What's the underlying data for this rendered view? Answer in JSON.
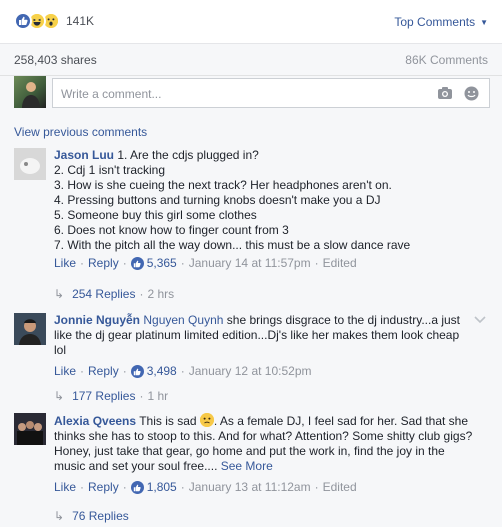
{
  "header": {
    "reaction_icons": [
      "like-icon",
      "haha-icon",
      "wow-icon"
    ],
    "reaction_count": "141K",
    "sort_label": "Top Comments",
    "shares": "258,403 shares",
    "comments": "86K Comments"
  },
  "composer": {
    "placeholder": "Write a comment..."
  },
  "view_previous": "View previous comments",
  "comments": [
    {
      "author": "Jason Luu",
      "lines": [
        "1. Are the cdjs plugged in?",
        "2. Cdj 1 isn't tracking",
        "3. How is she cueing the next track? Her headphones aren't on.",
        "4. Pressing buttons and turning knobs doesn't make you a DJ",
        "5. Someone buy this girl some clothes",
        "6. Does not know how to finger count from 3",
        "7. With the pitch all the way down... this must be a slow dance rave"
      ],
      "like": "Like",
      "reply": "Reply",
      "likes": "5,365",
      "time": "January 14 at 11:57pm",
      "edited": "Edited",
      "replies": "254 Replies",
      "reply_time": "2 hrs"
    },
    {
      "author": "Jonnie Nguyễn",
      "mention": "Nguyen Quynh",
      "lines": [
        "she brings disgrace to the dj industry...a just",
        "like the dj gear platinum limited edition...Dj's like her makes them look cheap",
        "lol"
      ],
      "like": "Like",
      "reply": "Reply",
      "likes": "3,498",
      "time": "January 12 at 10:52pm",
      "replies": "177 Replies",
      "reply_time": "1 hr"
    },
    {
      "author": "Alexia Qveens",
      "lines_before_emoji": "This is sad",
      "lines_after_emoji": ". As a female DJ, I feel sad for her. Sad that she",
      "lines": [
        "thinks she has to stoop to this. And for what? Attention? Some shitty club gigs?",
        "Honey, just take that gear, go home and put the work in, find the joy in the",
        "music and set your soul free...."
      ],
      "see_more": "See More",
      "like": "Like",
      "reply": "Reply",
      "likes": "1,805",
      "time": "January 13 at 11:12am",
      "edited": "Edited",
      "replies": "76 Replies"
    }
  ],
  "separator": "·"
}
